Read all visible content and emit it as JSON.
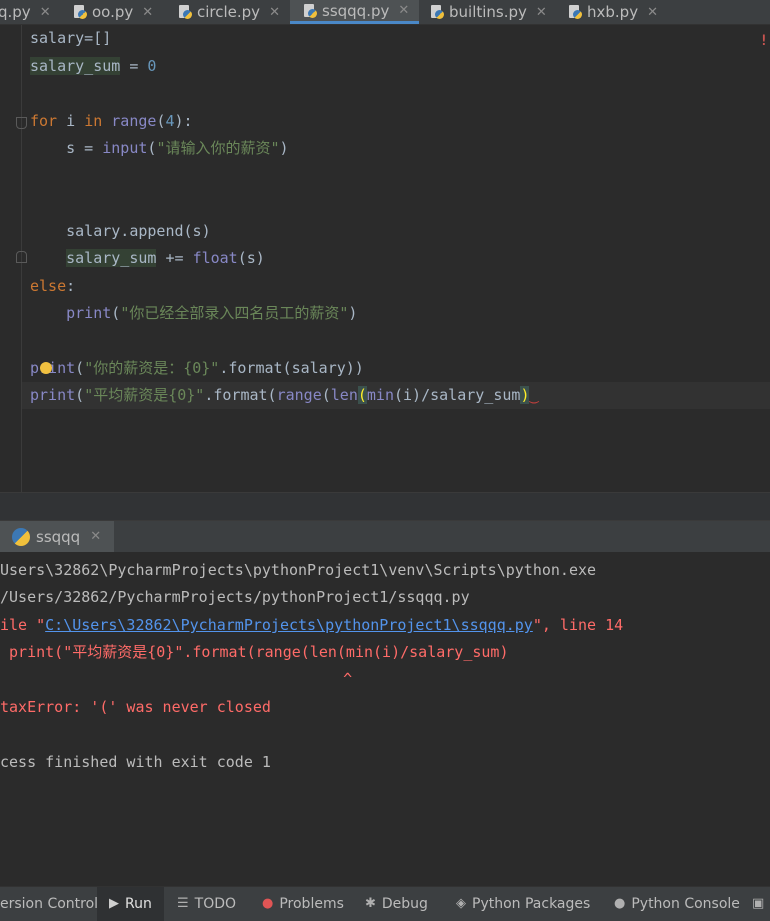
{
  "tabs": [
    {
      "label": "q.py",
      "active": false
    },
    {
      "label": "oo.py",
      "active": false
    },
    {
      "label": "circle.py",
      "active": false
    },
    {
      "label": "ssqqq.py",
      "active": true
    },
    {
      "label": "builtins.py",
      "active": false
    },
    {
      "label": "hxb.py",
      "active": false
    }
  ],
  "editor": {
    "l1": "salary=[]",
    "l2_var": "salary_sum",
    "l2_op": " = ",
    "l2_num": "0",
    "l3_kw": "for",
    "l3_a": " i ",
    "l3_kw2": "in",
    "l3_sp": " ",
    "l3_fn": "range",
    "l3_b": "(",
    "l3_num": "4",
    "l3_c": "):",
    "l4_a": "    s = ",
    "l4_fn": "input",
    "l4_b": "(",
    "l4_str": "\"请输入你的薪资\"",
    "l4_c": ")",
    "l5": "    salary.append(s)",
    "l6_ind": "    ",
    "l6_var": "salary_sum",
    "l6_a": " += ",
    "l6_fn": "float",
    "l6_b": "(s)",
    "l7_kw": "else",
    "l7_a": ":",
    "l8_ind": "    ",
    "l8_fn": "print",
    "l8_b": "(",
    "l8_str": "\"你已经全部录入四名员工的薪资\"",
    "l8_c": ")",
    "l9_fn": "print",
    "l9_b": "(",
    "l9_str": "\"你的薪资是：{0}\"",
    "l9_c": ".format(salary))",
    "l10_fn": "print",
    "l10_b": "(",
    "l10_str": "\"平均薪资是{0}\"",
    "l10_c": ".format(",
    "l10_fn2": "range",
    "l10_d": "(",
    "l10_fn3": "len",
    "l10_brace": "(",
    "l10_fn4": "min",
    "l10_e": "(i)/salary_sum",
    "l10_brace2": ")"
  },
  "run": {
    "tab_label": "ssqqq",
    "out1": "Users\\32862\\PycharmProjects\\pythonProject1\\venv\\Scripts\\python.exe",
    "out2": "/Users/32862/PycharmProjects/pythonProject1/ssqqq.py",
    "err3_a": "ile \"",
    "err3_link": "C:\\Users\\32862\\PycharmProjects\\pythonProject1\\ssqqq.py",
    "err3_b": "\", line 14",
    "err4": " print(\"平均薪资是{0}\".format(range(len(min(i)/salary_sum)",
    "err5": "                                      ^",
    "err6": "taxError: '(' was never closed",
    "out7": "cess finished with exit code 1"
  },
  "bottom_tools": [
    {
      "label": "ersion Control",
      "icon": "version-control-icon"
    },
    {
      "label": "Run",
      "icon": "run-icon"
    },
    {
      "label": "TODO",
      "icon": "todo-icon"
    },
    {
      "label": "Problems",
      "icon": "problems-icon"
    },
    {
      "label": "Debug",
      "icon": "debug-icon"
    },
    {
      "label": "Python Packages",
      "icon": "packages-icon"
    },
    {
      "label": "Python Console",
      "icon": "python-console-icon"
    }
  ],
  "colors": {
    "keyword": "#cc7832",
    "string": "#6a8759",
    "number": "#6897bb",
    "builtin": "#8888c6",
    "error": "#ff6b68",
    "link": "#5394ec",
    "accent": "#4a88c7"
  }
}
